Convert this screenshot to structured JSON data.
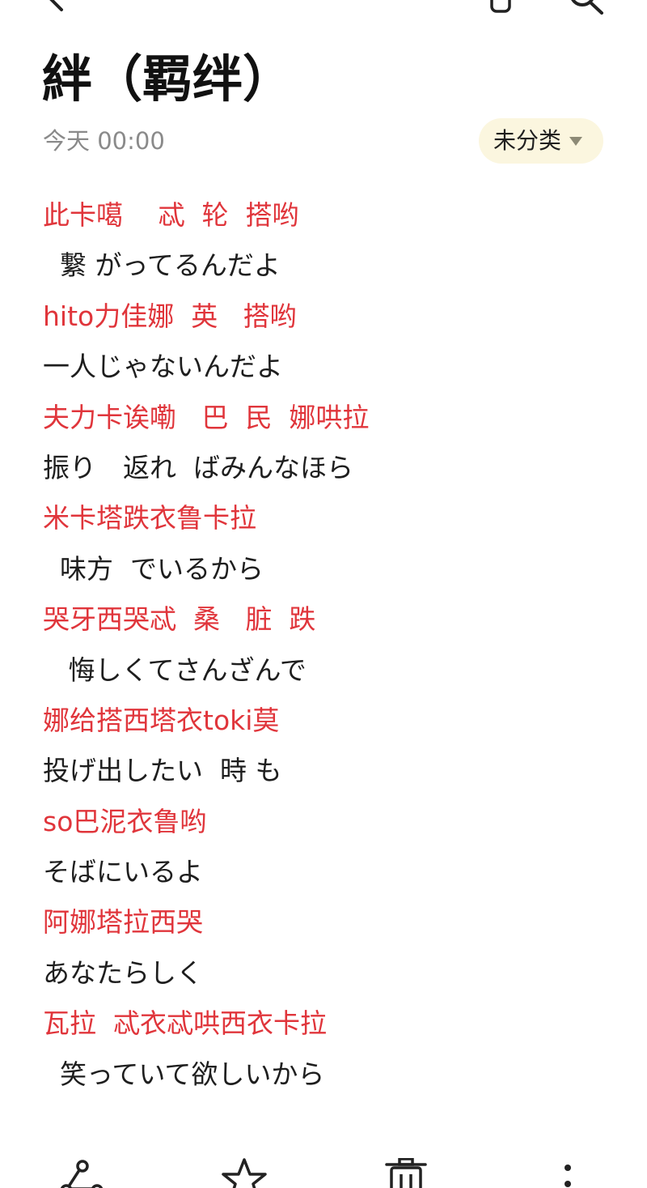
{
  "header": {
    "back_icon": "chevron-left-icon",
    "attach_icon": "attachment-icon",
    "search_icon": "search-icon"
  },
  "note": {
    "title": "絆（羁绊）",
    "date": "今天 00:00",
    "category": {
      "label": "未分类",
      "icon": "caret-down-icon",
      "background": "#fbf6df"
    },
    "colors": {
      "romanization": "#e0353b",
      "lyrics": "#1e1e1e"
    },
    "lines": [
      {
        "text": "此卡噶　 忒  轮  搭哟",
        "style": "red"
      },
      {
        "text": "  繋 がってるんだよ",
        "style": "black"
      },
      {
        "text": "hito力佳娜  英   搭哟",
        "style": "red"
      },
      {
        "text": "一人じゃないんだよ",
        "style": "black"
      },
      {
        "text": "夫力卡诶嘞   巴  民  娜哄拉",
        "style": "red"
      },
      {
        "text": "振り　返れ  ばみんなほら",
        "style": "black"
      },
      {
        "text": "米卡塔跌衣鲁卡拉",
        "style": "red"
      },
      {
        "text": "  味方  でいるから",
        "style": "black"
      },
      {
        "text": "哭牙西哭忒  桑   脏  跌",
        "style": "red"
      },
      {
        "text": "   悔しくてさんざんで",
        "style": "black"
      },
      {
        "text": "娜给搭西塔衣toki莫",
        "style": "red"
      },
      {
        "text": "投げ出したい  時 も",
        "style": "black"
      },
      {
        "text": "so巴泥衣鲁哟",
        "style": "red"
      },
      {
        "text": "そばにいるよ",
        "style": "black"
      },
      {
        "text": "阿娜塔拉西哭",
        "style": "red"
      },
      {
        "text": "あなたらしく",
        "style": "black"
      },
      {
        "text": "瓦拉  忒衣忒哄西衣卡拉",
        "style": "red"
      },
      {
        "text": "  笑っていて欲しいから",
        "style": "black"
      }
    ]
  },
  "bottom_bar": {
    "share_icon": "share-icon",
    "favorite_icon": "star-icon",
    "delete_icon": "trash-icon",
    "more_icon": "more-vertical-icon"
  }
}
